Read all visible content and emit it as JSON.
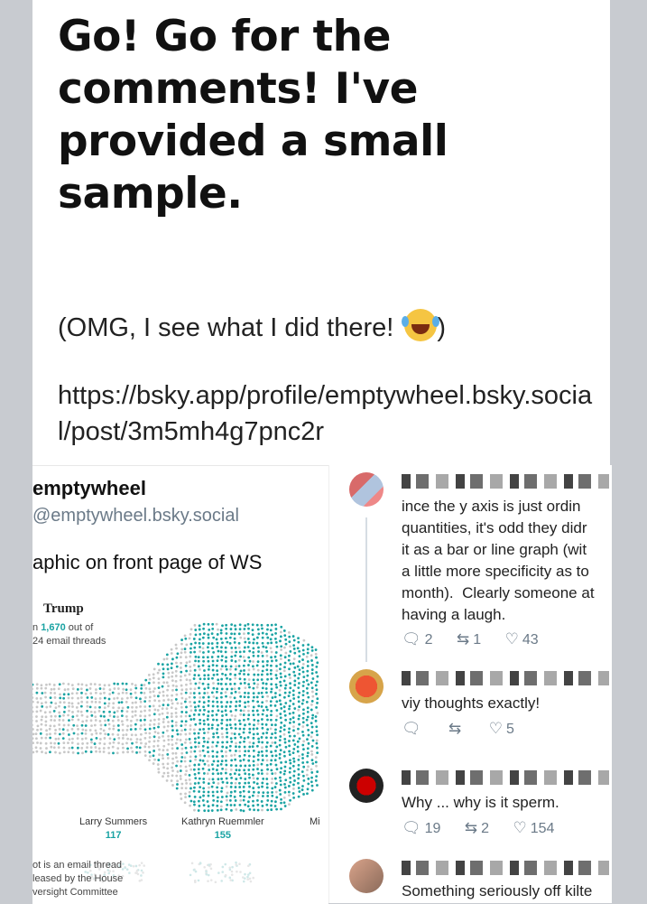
{
  "post": {
    "headline": "Go! Go for the comments! I've provided a small sample.",
    "para1": "(OMG, I see what I did there! ",
    "para1_end": ")",
    "emoji": "rolling-on-floor-laughing-emoji",
    "link": "https://bsky.app/profile/emptywheel.bsky.social/post/3m5mh4g7pnc2r"
  },
  "embedded_left": {
    "name": "emptywheel",
    "handle": "@emptywheel.bsky.social",
    "text": "aphic on front page of WS",
    "wsj": {
      "title": "Trump",
      "sub_prefix": "n ",
      "sub_num": "1,670",
      "sub_suffix": " out of",
      "sub_line2": "24 email threads",
      "note_lines": [
        "ot is an email thread",
        "leased by the House",
        "versight Committee"
      ],
      "people": [
        {
          "name": "Larry Summers",
          "value": "117"
        },
        {
          "name": "Kathryn Ruemmler",
          "value": "155"
        },
        {
          "name": "Mi",
          "value": ""
        }
      ],
      "dot_color": "#1aa3a3",
      "grey_dot_color": "#c8c8c8"
    }
  },
  "embedded_right": {
    "comments": [
      {
        "text": "ince the y axis is just ordin\nquantities, it's odd they didr\nit as a bar or line graph (wit\na little more specificity as to\nmonth).  Clearly someone at\nhaving a laugh.",
        "replies": "2",
        "reposts": "1",
        "likes": "43"
      },
      {
        "text": "viy thoughts exactly!",
        "replies": "",
        "reposts": "",
        "likes": "5"
      },
      {
        "text": "Why ... why is it sperm.",
        "replies": "19",
        "reposts": "2",
        "likes": "154"
      },
      {
        "text": "Something seriously off kilte",
        "replies": "",
        "reposts": "",
        "likes": ""
      }
    ]
  },
  "colors": {
    "accent": "#1aa3a3",
    "muted": "#6b7a88",
    "background": "#c8cbd0"
  }
}
